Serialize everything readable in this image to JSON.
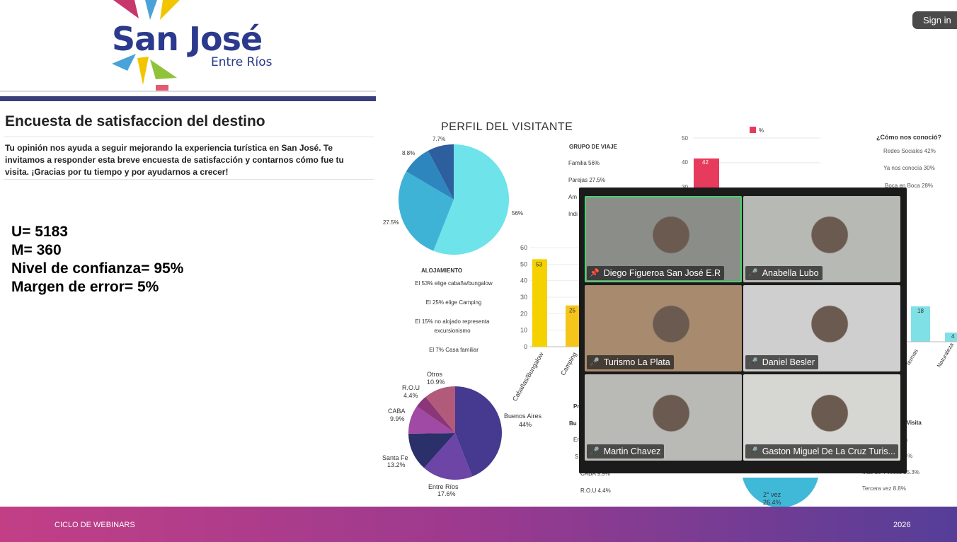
{
  "brand": {
    "title": "San José",
    "subtitle": "Entre Ríos"
  },
  "top_right": {
    "signin_label": "Sign in"
  },
  "survey": {
    "title": "Encuesta de satisfaccion del destino",
    "description": "Tu opinión nos ayuda a seguir mejorando la experiencia turística en San José. Te invitamos a responder esta breve encuesta de satisfacción y contarnos cómo fue tu visita. ¡Gracias por tu tiempo y por ayudarnos a crecer!",
    "stats": [
      "U= 5183",
      "M= 360",
      "Nivel de confianza= 95%",
      "Margen de error= 5%"
    ]
  },
  "slide": {
    "title": "PERFIL DEL VISITANTE",
    "grupo": {
      "title": "GRUPO DE VIAJE",
      "items": [
        "Familia 56%",
        "Parejas 27.5%",
        "Am",
        "Indi"
      ]
    },
    "alojamiento": {
      "title": "ALOJAMIENTO",
      "lines": [
        "El 53% elige cabaña/bungalow",
        "El 25%  elige Camping",
        "El 15% no alojado representa",
        "excursionismo",
        "El 7% Casa familiar"
      ]
    },
    "procedencia": {
      "header_partial": "Pr",
      "items": [
        "Bu",
        "Er",
        "S",
        "CABA 9.9%",
        "R.O.U 4.4%"
      ]
    },
    "como_conocio": {
      "title": "¿Cómo nos conoció?",
      "items": [
        "Redes Sociales 42%",
        "Ya nos conocía 30%",
        "Boca en Boca 28%"
      ]
    },
    "visita": {
      "title_partial": "e Visita",
      "items": [
        "6%",
        "6.4%",
        "Más de 4 veces 25.3%",
        "Tercera vez 8.8%"
      ],
      "pie_label": "2° vez",
      "pie_value": "26.4%"
    },
    "legend_pct": "%",
    "right_bar_labels": [
      "Termas",
      "Naturaleza"
    ],
    "right_bar_values": [
      "18",
      "4"
    ],
    "right_axis_ticks": [
      "50",
      "40",
      "30"
    ],
    "bar42_label": "42"
  },
  "chart_data": [
    {
      "type": "pie",
      "title": "",
      "slices": [
        {
          "label": "56%",
          "value": 56
        },
        {
          "label": "27.5%",
          "value": 27.5
        },
        {
          "label": "8.8%",
          "value": 8.8
        },
        {
          "label": "7.7%",
          "value": 7.7
        }
      ],
      "colors": [
        "#6ee3ea",
        "#3fb3d6",
        "#2e86bf",
        "#2d5f9e"
      ]
    },
    {
      "type": "bar",
      "title": "",
      "categories": [
        "Cabañas/Bungalow",
        "Camping"
      ],
      "values": [
        53,
        25
      ],
      "value_labels": [
        "53",
        "25"
      ],
      "y_ticks": [
        "60",
        "50",
        "40",
        "30",
        "20",
        "10",
        "0"
      ],
      "ylim": [
        0,
        60
      ],
      "colors": [
        "#f5d100",
        "#f5c51c"
      ]
    },
    {
      "type": "pie",
      "title": "",
      "slices": [
        {
          "label": "Buenos Aires",
          "value_label": "44%",
          "value": 44
        },
        {
          "label": "Entre Ríos",
          "value_label": "17.6%",
          "value": 17.6
        },
        {
          "label": "Santa Fe",
          "value_label": "13.2%",
          "value": 13.2
        },
        {
          "label": "CABA",
          "value_label": "9.9%",
          "value": 9.9
        },
        {
          "label": "R.O.U",
          "value_label": "4.4%",
          "value": 4.4
        },
        {
          "label": "Otros",
          "value_label": "10.9%",
          "value": 10.9
        }
      ],
      "colors": [
        "#453a90",
        "#6c45a6",
        "#2b2f6a",
        "#a04aa5",
        "#8b3678",
        "#b25a7a"
      ]
    }
  ],
  "meeting": {
    "participants": [
      {
        "name": "Diego Figueroa San José E.R",
        "pinned": true,
        "muted": false,
        "active": true,
        "bg": "#8a8d88"
      },
      {
        "name": "Anabella Lubo",
        "pinned": false,
        "muted": true,
        "active": false,
        "bg": "#b7b9b4"
      },
      {
        "name": "Turismo La Plata",
        "pinned": false,
        "muted": true,
        "active": false,
        "bg": "#a88a6e"
      },
      {
        "name": "Daniel Besler",
        "pinned": false,
        "muted": true,
        "active": false,
        "bg": "#cfcfcf"
      },
      {
        "name": "Martin Chavez",
        "pinned": false,
        "muted": true,
        "active": false,
        "bg": "#b9b9b6"
      },
      {
        "name": "Gaston Miguel De La Cruz Turis...",
        "pinned": false,
        "muted": true,
        "active": false,
        "bg": "#d6d6d3"
      }
    ]
  },
  "footer": {
    "left": "CICLO DE WEBINARS",
    "right": "2026"
  }
}
